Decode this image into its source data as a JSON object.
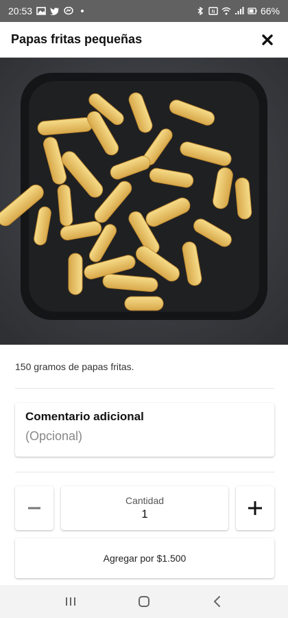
{
  "status_bar": {
    "time": "20:53",
    "battery": "66%",
    "left_icons": [
      "image-icon",
      "twitter-icon",
      "messenger-icon",
      "dot-icon"
    ],
    "right_icons": [
      "bluetooth-icon",
      "nfc-icon",
      "wifi-icon",
      "signal-icon",
      "battery-icon"
    ]
  },
  "header": {
    "title": "Papas fritas pequeñas",
    "close_icon": "close-icon"
  },
  "product": {
    "image_icon": "fries-photo",
    "description": "150 gramos de papas fritas."
  },
  "comment": {
    "title": "Comentario adicional",
    "placeholder": "(Opcional)",
    "value": ""
  },
  "quantity": {
    "label": "Cantidad",
    "value": "1",
    "decrement_icon": "minus-icon",
    "increment_icon": "plus-icon"
  },
  "add_button": {
    "label": "Agregar por $1.500"
  },
  "nav_bar": {
    "icons": [
      "recent-apps-icon",
      "home-icon",
      "back-icon"
    ]
  },
  "colors": {
    "status_bar_bg": "#616161",
    "hero_bg": "#3a3d41",
    "plate": "#1f2022",
    "fries": "#e9c46a",
    "nav_bar_bg": "#f3f3f3"
  }
}
